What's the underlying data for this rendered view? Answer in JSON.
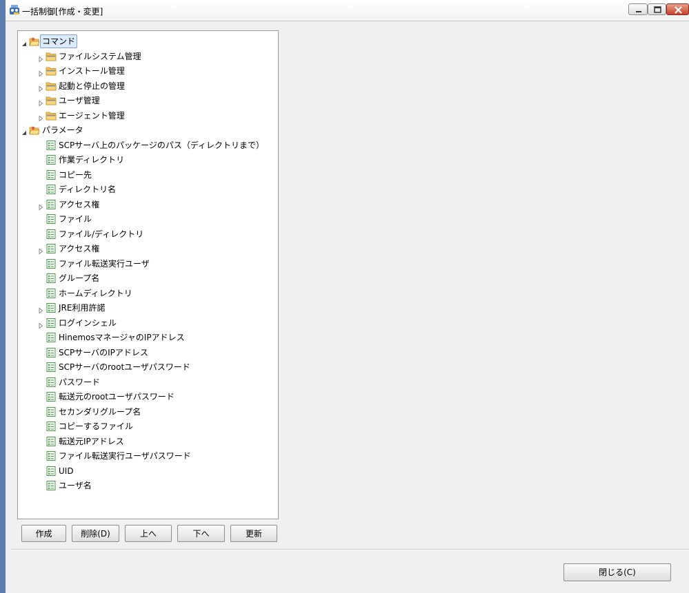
{
  "window": {
    "title": "一括制御[作成・変更]"
  },
  "tree": {
    "items": [
      {
        "label": "コマンド",
        "level": 0,
        "expander": "expanded",
        "icon": "folder-open-icon",
        "selected": true
      },
      {
        "label": "ファイルシステム管理",
        "level": 1,
        "expander": "collapsed",
        "icon": "folder-icon"
      },
      {
        "label": "インストール管理",
        "level": 1,
        "expander": "collapsed",
        "icon": "folder-icon"
      },
      {
        "label": "起動と停止の管理",
        "level": 1,
        "expander": "collapsed",
        "icon": "folder-icon"
      },
      {
        "label": "ユーザ管理",
        "level": 1,
        "expander": "collapsed",
        "icon": "folder-icon"
      },
      {
        "label": "エージェント管理",
        "level": 1,
        "expander": "collapsed",
        "icon": "folder-icon"
      },
      {
        "label": "パラメータ",
        "level": 0,
        "expander": "expanded",
        "icon": "folder-open-icon"
      },
      {
        "label": "SCPサーバ上のパッケージのパス（ディレクトリまで）",
        "level": 1,
        "expander": "none",
        "icon": "parameter-icon"
      },
      {
        "label": "作業ディレクトリ",
        "level": 1,
        "expander": "none",
        "icon": "parameter-icon"
      },
      {
        "label": "コピー先",
        "level": 1,
        "expander": "none",
        "icon": "parameter-icon"
      },
      {
        "label": "ディレクトリ名",
        "level": 1,
        "expander": "none",
        "icon": "parameter-icon"
      },
      {
        "label": "アクセス権",
        "level": 1,
        "expander": "collapsed",
        "icon": "parameter-icon"
      },
      {
        "label": "ファイル",
        "level": 1,
        "expander": "none",
        "icon": "parameter-icon"
      },
      {
        "label": "ファイル/ディレクトリ",
        "level": 1,
        "expander": "none",
        "icon": "parameter-icon"
      },
      {
        "label": "アクセス権",
        "level": 1,
        "expander": "collapsed",
        "icon": "parameter-icon"
      },
      {
        "label": "ファイル転送実行ユーザ",
        "level": 1,
        "expander": "none",
        "icon": "parameter-icon"
      },
      {
        "label": "グループ名",
        "level": 1,
        "expander": "none",
        "icon": "parameter-icon"
      },
      {
        "label": "ホームディレクトリ",
        "level": 1,
        "expander": "none",
        "icon": "parameter-icon"
      },
      {
        "label": "JRE利用許諾",
        "level": 1,
        "expander": "collapsed",
        "icon": "parameter-icon"
      },
      {
        "label": "ログインシェル",
        "level": 1,
        "expander": "collapsed",
        "icon": "parameter-icon"
      },
      {
        "label": "HinemosマネージャのIPアドレス",
        "level": 1,
        "expander": "none",
        "icon": "parameter-icon"
      },
      {
        "label": "SCPサーバのIPアドレス",
        "level": 1,
        "expander": "none",
        "icon": "parameter-icon"
      },
      {
        "label": "SCPサーバのrootユーザパスワード",
        "level": 1,
        "expander": "none",
        "icon": "parameter-icon"
      },
      {
        "label": "パスワード",
        "level": 1,
        "expander": "none",
        "icon": "parameter-icon"
      },
      {
        "label": "転送元のrootユーザパスワード",
        "level": 1,
        "expander": "none",
        "icon": "parameter-icon"
      },
      {
        "label": "セカンダリグループ名",
        "level": 1,
        "expander": "none",
        "icon": "parameter-icon"
      },
      {
        "label": "コピーするファイル",
        "level": 1,
        "expander": "none",
        "icon": "parameter-icon"
      },
      {
        "label": "転送元IPアドレス",
        "level": 1,
        "expander": "none",
        "icon": "parameter-icon"
      },
      {
        "label": "ファイル転送実行ユーザパスワード",
        "level": 1,
        "expander": "none",
        "icon": "parameter-icon"
      },
      {
        "label": "UID",
        "level": 1,
        "expander": "none",
        "icon": "parameter-icon"
      },
      {
        "label": "ユーザ名",
        "level": 1,
        "expander": "none",
        "icon": "parameter-icon"
      }
    ]
  },
  "buttons": {
    "create": "作成",
    "delete": "削除(D)",
    "up": "上へ",
    "down": "下へ",
    "refresh": "更新",
    "close": "閉じる(C)"
  },
  "colors": {
    "window_frame": "#5d7fb0",
    "selection": "#dcebfc",
    "folder": "#f2c25b",
    "parameter_icon": "#4a9a4a"
  }
}
